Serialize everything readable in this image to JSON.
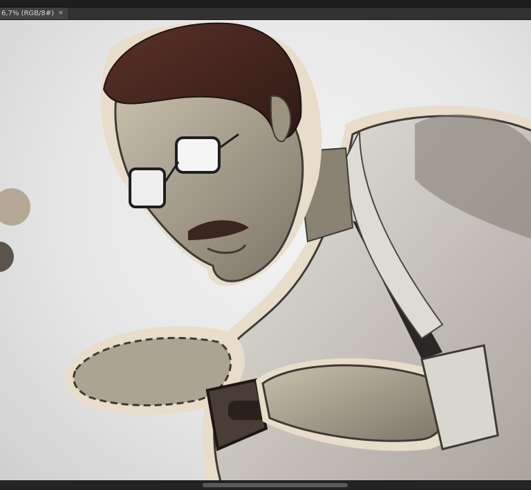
{
  "document_tab": {
    "title": "6,7% (RGB/8#)",
    "close_glyph": "×"
  },
  "colors": {
    "canvas_bg": "#e8e8e8",
    "outline_halo": "#e8dccb",
    "skin": "#a8a08e",
    "hair": "#4a2a22",
    "suit": "#cfcbc4",
    "swatch_light": "#b5a896",
    "swatch_dark": "#5a544c"
  },
  "icons": {
    "tab_close": "close-icon"
  }
}
